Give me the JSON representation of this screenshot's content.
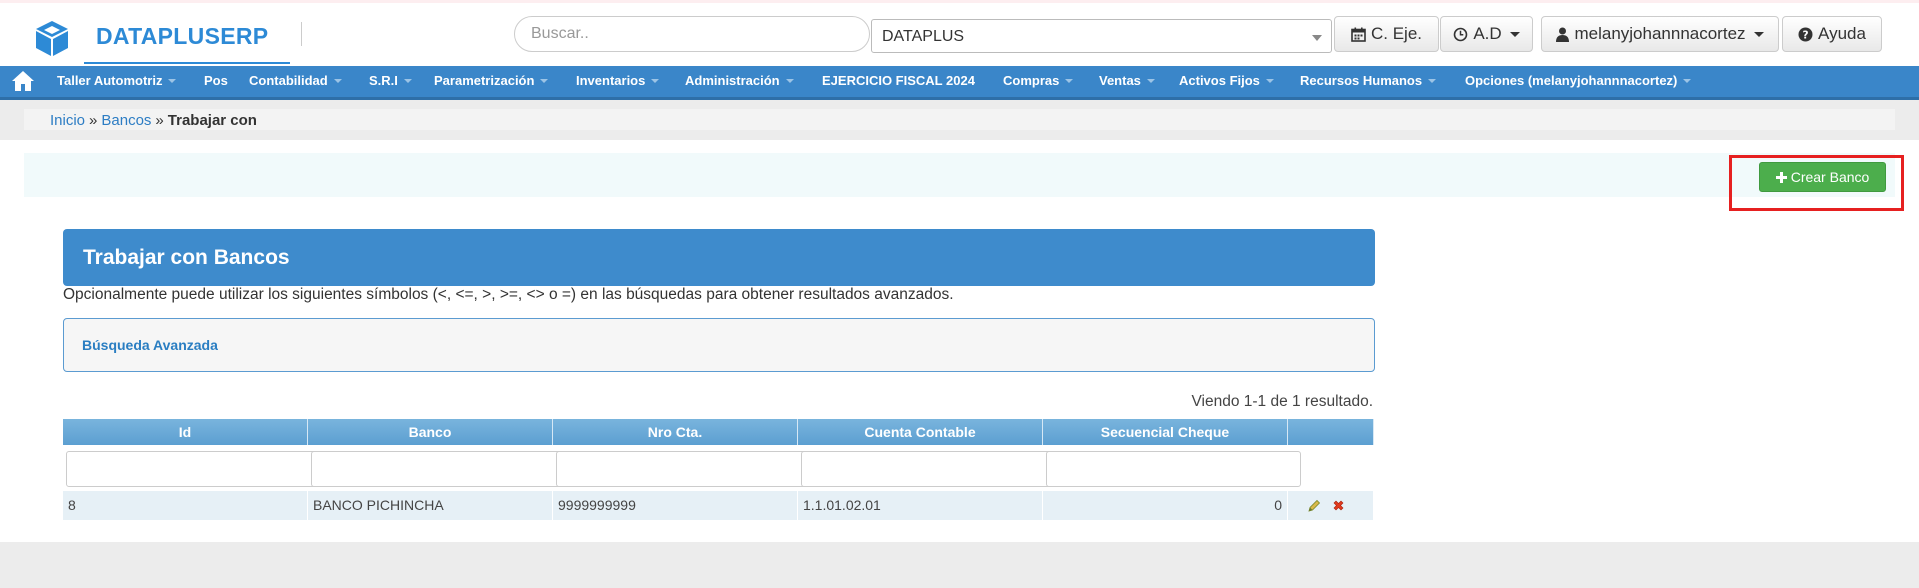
{
  "app": {
    "brand_name": "DATAPLUSERP"
  },
  "header": {
    "search_placeholder": "Buscar..",
    "company_selected": "DATAPLUS",
    "ceje_label": "C. Eje.",
    "ad_label": "A.D",
    "user_label": "melanyjohannnacortez",
    "help_label": "Ayuda"
  },
  "nav": {
    "items": [
      {
        "label": "Taller Automotriz"
      },
      {
        "label": "Pos"
      },
      {
        "label": "Contabilidad"
      },
      {
        "label": "S.R.I"
      },
      {
        "label": "Parametrización"
      },
      {
        "label": "Inventarios"
      },
      {
        "label": "Administración"
      },
      {
        "label": "EJERCICIO FISCAL 2024"
      },
      {
        "label": "Compras"
      },
      {
        "label": "Ventas"
      },
      {
        "label": "Activos Fijos"
      },
      {
        "label": "Recursos Humanos"
      },
      {
        "label": "Opciones (melanyjohannnacortez)"
      }
    ]
  },
  "breadcrumb": {
    "home": "Inicio",
    "separator": "»",
    "parent": "Bancos",
    "current": "Trabajar con"
  },
  "actions": {
    "create_label": "Crear Banco",
    "create_color": "#4cae4c",
    "highlight_color": "#e62020"
  },
  "panel": {
    "title": "Trabajar con Bancos",
    "hint": "Opcionalmente puede utilizar los siguientes símbolos (<, <=, >, >=, <> o =) en las búsquedas para obtener resultados avanzados.",
    "advanced_search_label": "Búsqueda Avanzada"
  },
  "grid": {
    "summary": "Viendo 1-1 de 1 resultado.",
    "columns": [
      "Id",
      "Banco",
      "Nro Cta.",
      "Cuenta Contable",
      "Secuencial Cheque"
    ],
    "rows": [
      {
        "id": "8",
        "banco": "BANCO PICHINCHA",
        "nro_cta": "9999999999",
        "cuenta_contable": "1.1.01.02.01",
        "secuencial_cheque": "0"
      }
    ]
  },
  "colors": {
    "primary": "#3e8bcc",
    "navbar": "#3a86c9",
    "brand": "#2d8ad6"
  }
}
